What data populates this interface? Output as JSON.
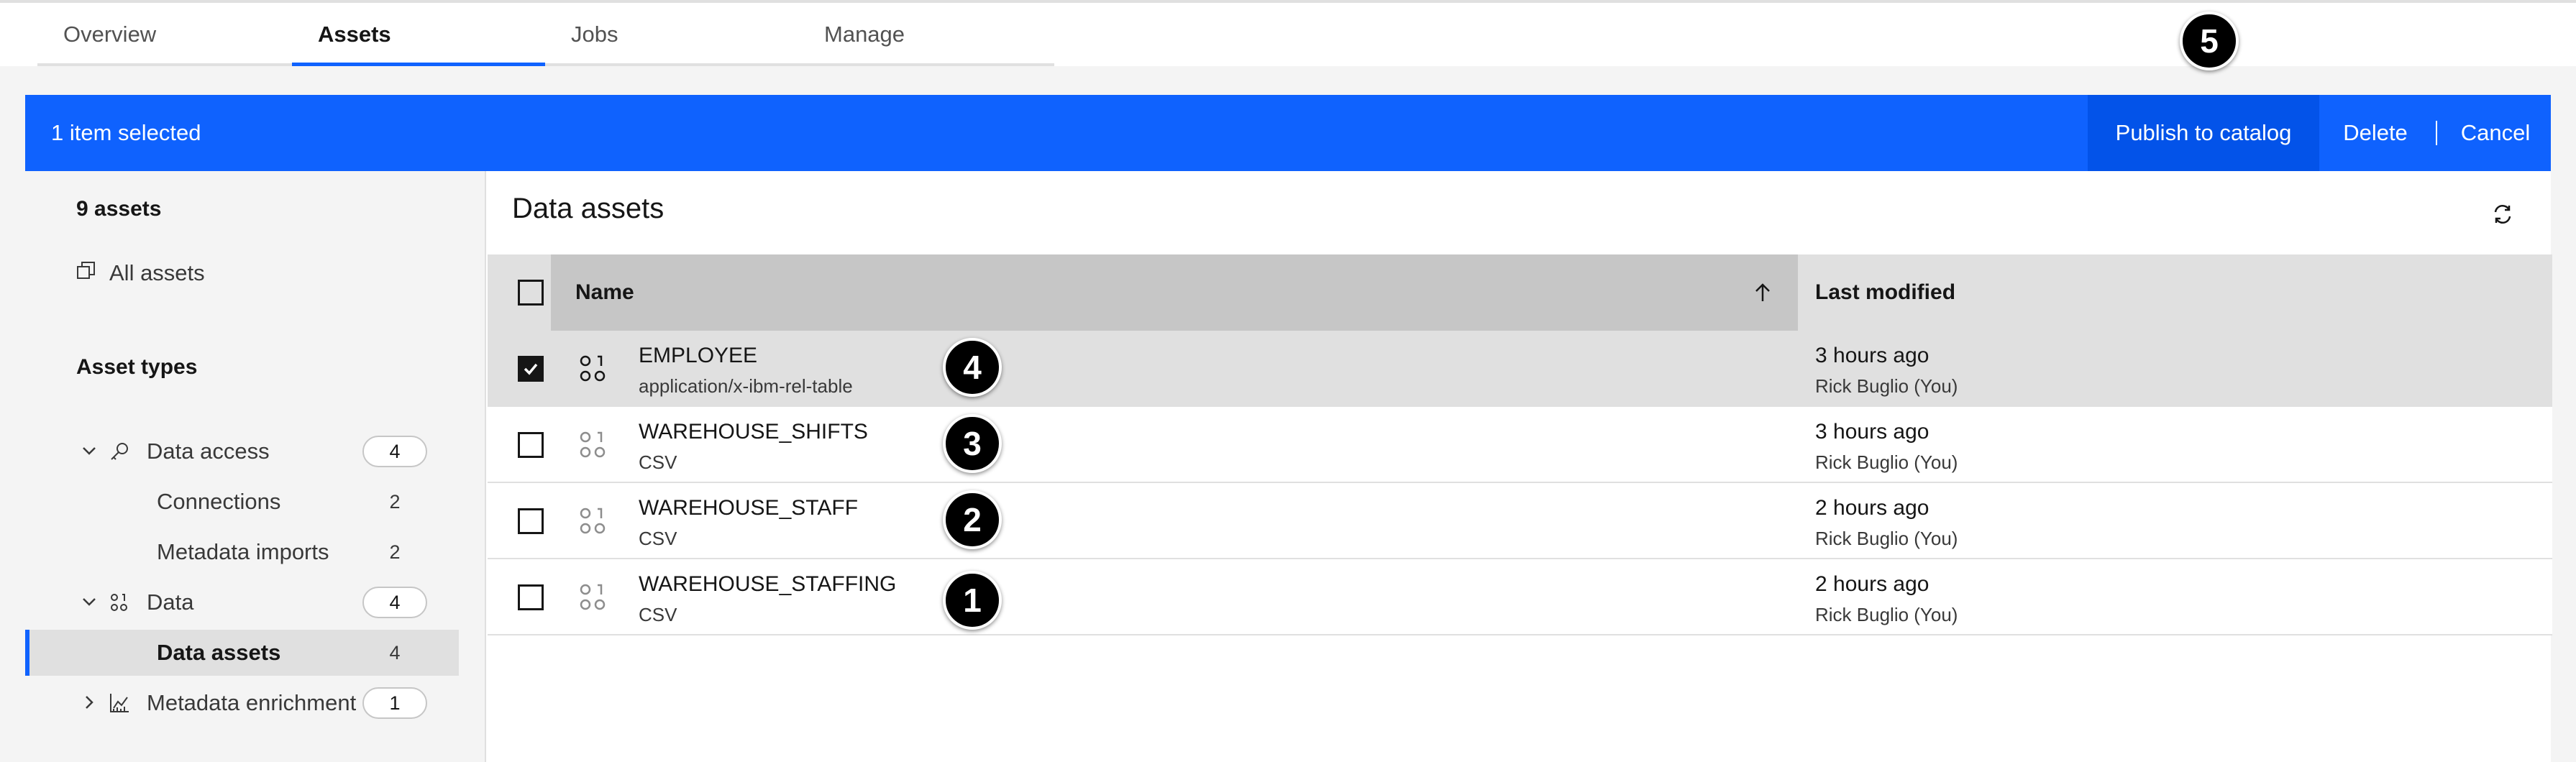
{
  "tabs": [
    {
      "label": "Overview"
    },
    {
      "label": "Assets"
    },
    {
      "label": "Jobs"
    },
    {
      "label": "Manage"
    }
  ],
  "callouts": [
    "1",
    "2",
    "3",
    "4",
    "5"
  ],
  "selection_bar": {
    "text": "1 item selected",
    "publish": "Publish to catalog",
    "delete": "Delete",
    "cancel": "Cancel"
  },
  "sidebar": {
    "count": "9 assets",
    "all_assets": "All assets",
    "heading": "Asset types",
    "tree": [
      {
        "label": "Data access",
        "count": "4",
        "expanded": true,
        "icon": "key-icon"
      },
      {
        "label": "Connections",
        "count": "2"
      },
      {
        "label": "Metadata imports",
        "count": "2"
      },
      {
        "label": "Data",
        "count": "4",
        "expanded": true,
        "icon": "data-icon"
      },
      {
        "label": "Data assets",
        "count": "4",
        "selected": true
      },
      {
        "label": "Metadata enrichment",
        "count": "1",
        "expanded": false,
        "icon": "chart-icon"
      }
    ]
  },
  "main": {
    "title": "Data assets",
    "columns": {
      "name": "Name",
      "modified": "Last modified"
    },
    "rows": [
      {
        "name": "EMPLOYEE",
        "type": "application/x-ibm-rel-table",
        "time": "3 hours ago",
        "user": "Rick Buglio (You)",
        "selected": true
      },
      {
        "name": "WAREHOUSE_SHIFTS",
        "type": "CSV",
        "time": "3 hours ago",
        "user": "Rick Buglio (You)",
        "selected": false
      },
      {
        "name": "WAREHOUSE_STAFF",
        "type": "CSV",
        "time": "2 hours ago",
        "user": "Rick Buglio (You)",
        "selected": false
      },
      {
        "name": "WAREHOUSE_STAFFING",
        "type": "CSV",
        "time": "2 hours ago",
        "user": "Rick Buglio (You)",
        "selected": false
      }
    ]
  },
  "colors": {
    "accent": "#0f62fe",
    "accent_dark": "#0353e9",
    "selected_row": "#e0e0e0",
    "header_sorted": "#c6c6c6"
  }
}
